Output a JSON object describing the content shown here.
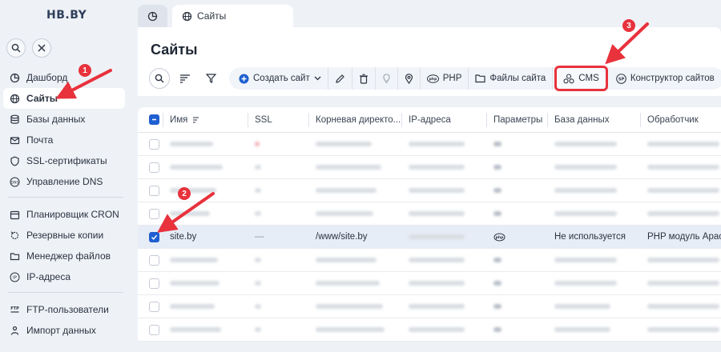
{
  "app": {
    "logo": "HB.BY"
  },
  "sidebar": {
    "items": [
      {
        "label": "Дашборд",
        "icon": "dashboard-icon"
      },
      {
        "label": "Сайты",
        "icon": "globe-icon",
        "active": true
      },
      {
        "label": "Базы данных",
        "icon": "database-icon"
      },
      {
        "label": "Почта",
        "icon": "mail-icon"
      },
      {
        "label": "SSL-сертификаты",
        "icon": "ssl-icon"
      },
      {
        "label": "Управление DNS",
        "icon": "dns-icon"
      },
      {
        "label": "Планировщик CRON",
        "icon": "calendar-icon"
      },
      {
        "label": "Резервные копии",
        "icon": "backup-icon"
      },
      {
        "label": "Менеджер файлов",
        "icon": "folder-icon"
      },
      {
        "label": "IP-адреса",
        "icon": "ip-icon"
      },
      {
        "label": "FTP-пользователи",
        "icon": "ftp-icon"
      },
      {
        "label": "Импорт данных",
        "icon": "import-icon"
      }
    ]
  },
  "tabs": [
    {
      "label": "",
      "icon": "dashboard-icon"
    },
    {
      "label": "Сайты",
      "icon": "globe-icon"
    }
  ],
  "page": {
    "title": "Сайты"
  },
  "toolbar": {
    "create": "Создать сайт",
    "php": "PHP",
    "files": "Файлы сайта",
    "cms": "CMS",
    "builder": "Конструктор сайтов"
  },
  "table": {
    "columns": [
      "Имя",
      "SSL",
      "Корневая директо...",
      "IP-адреса",
      "Параметры",
      "База данных",
      "Обработчик"
    ],
    "selected_row": {
      "name": "site.by",
      "ssl": "—",
      "root": "/www/site.by",
      "db": "Не используется",
      "handler": "PHP модуль Apache"
    }
  },
  "annotations": [
    "1",
    "2",
    "3"
  ],
  "colors": {
    "accent": "#1f5fd0",
    "highlight": "#e8323c"
  }
}
